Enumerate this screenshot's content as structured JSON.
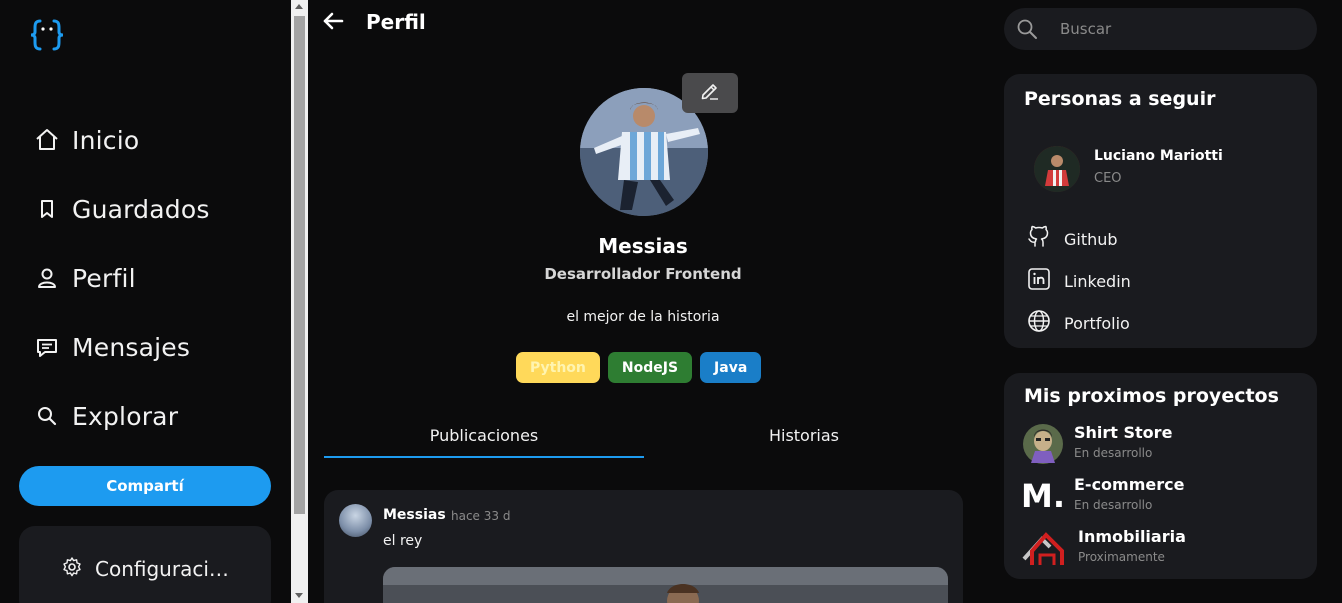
{
  "app": {
    "logo": "curly-braces-logo"
  },
  "sidebar": {
    "items": [
      {
        "label": "Inicio",
        "icon": "home-icon"
      },
      {
        "label": "Guardados",
        "icon": "bookmark-icon"
      },
      {
        "label": "Perfil",
        "icon": "user-icon"
      },
      {
        "label": "Mensajes",
        "icon": "message-icon"
      },
      {
        "label": "Explorar",
        "icon": "search-icon"
      }
    ],
    "share_label": "Compartí",
    "config_label": "Configuraci…"
  },
  "header": {
    "title": "Perfil"
  },
  "profile": {
    "name": "Messias",
    "role": "Desarrollador Frontend",
    "bio": "el mejor de la historia",
    "tags": [
      {
        "label": "Python",
        "bg": "#ffd95a",
        "fg": "#fff4b0"
      },
      {
        "label": "NodeJS",
        "bg": "#2e7d32",
        "fg": "#ffffff"
      },
      {
        "label": "Java",
        "bg": "#1a7ec8",
        "fg": "#ffffff"
      }
    ]
  },
  "tabs": [
    {
      "label": "Publicaciones",
      "active": true
    },
    {
      "label": "Historias",
      "active": false
    }
  ],
  "post": {
    "author": "Messias",
    "time": "hace 33 d",
    "text": "el rey"
  },
  "search": {
    "placeholder": "Buscar"
  },
  "follow_card": {
    "title": "Personas a seguir",
    "person": {
      "name": "Luciano Mariotti",
      "role": "CEO"
    },
    "links": [
      {
        "label": "Github",
        "icon": "github-icon"
      },
      {
        "label": "Linkedin",
        "icon": "linkedin-icon"
      },
      {
        "label": "Portfolio",
        "icon": "globe-icon"
      }
    ]
  },
  "projects_card": {
    "title": "Mis proximos proyectos",
    "items": [
      {
        "name": "Shirt Store",
        "status": "En desarrollo"
      },
      {
        "name": "E-commerce",
        "status": "En desarrollo",
        "logo_text": "M."
      },
      {
        "name": "Inmobiliaria",
        "status": "Proximamente"
      }
    ]
  },
  "colors": {
    "accent": "#1d9bf0",
    "card": "#1a1b1f",
    "background": "#0b0b0c"
  }
}
